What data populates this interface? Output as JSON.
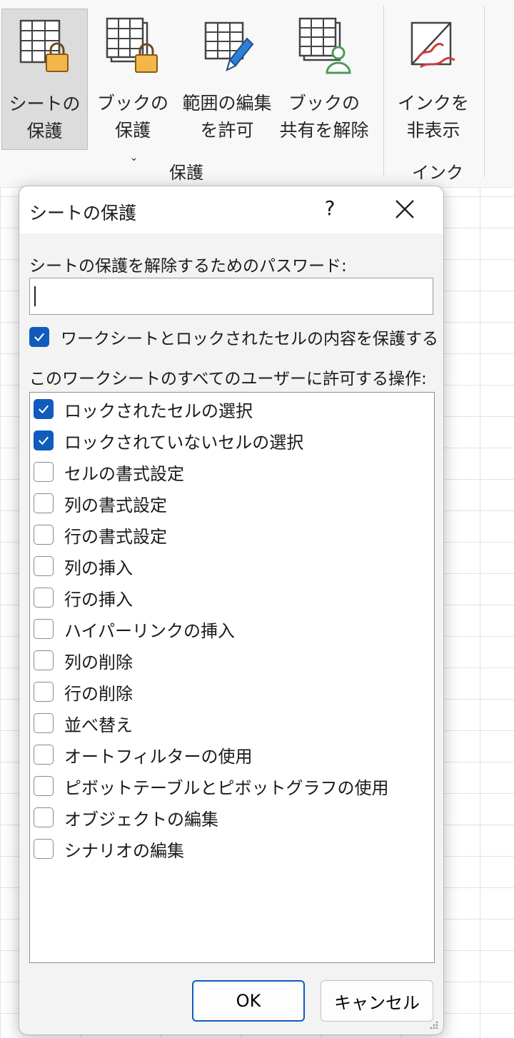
{
  "ribbon": {
    "buttons": [
      {
        "line1": "シートの",
        "line2": "保護"
      },
      {
        "line1": "ブックの",
        "line2": "保護",
        "caret": "⌄"
      },
      {
        "line1": "範囲の編集",
        "line2": "を許可"
      },
      {
        "line1": "ブックの",
        "line2": "共有を解除"
      },
      {
        "line1": "インクを",
        "line2": "非表示"
      }
    ],
    "groups": [
      {
        "label": "保護"
      },
      {
        "label": "インク"
      }
    ]
  },
  "dialog": {
    "title": "シートの保護",
    "help": "?",
    "password_label": "シートの保護を解除するためのパスワード:",
    "password_value": "",
    "protect_label": "ワークシートとロックされたセルの内容を保護する",
    "protect_checked": true,
    "allow_label": "このワークシートのすべてのユーザーに許可する操作:",
    "options": [
      {
        "label": "ロックされたセルの選択",
        "checked": true
      },
      {
        "label": "ロックされていないセルの選択",
        "checked": true
      },
      {
        "label": "セルの書式設定",
        "checked": false
      },
      {
        "label": "列の書式設定",
        "checked": false
      },
      {
        "label": "行の書式設定",
        "checked": false
      },
      {
        "label": "列の挿入",
        "checked": false
      },
      {
        "label": "行の挿入",
        "checked": false
      },
      {
        "label": "ハイパーリンクの挿入",
        "checked": false
      },
      {
        "label": "列の削除",
        "checked": false
      },
      {
        "label": "行の削除",
        "checked": false
      },
      {
        "label": "並べ替え",
        "checked": false
      },
      {
        "label": "オートフィルターの使用",
        "checked": false
      },
      {
        "label": "ピボットテーブルとピボットグラフの使用",
        "checked": false
      },
      {
        "label": "オブジェクトの編集",
        "checked": false
      },
      {
        "label": "シナリオの編集",
        "checked": false
      }
    ],
    "ok_label": "OK",
    "cancel_label": "キャンセル"
  },
  "colors": {
    "accent": "#0f5cbc",
    "lock": "#f2b64b",
    "pen": "#2f7fd6",
    "person": "#4a9c57",
    "ink": "#d23a3a"
  }
}
